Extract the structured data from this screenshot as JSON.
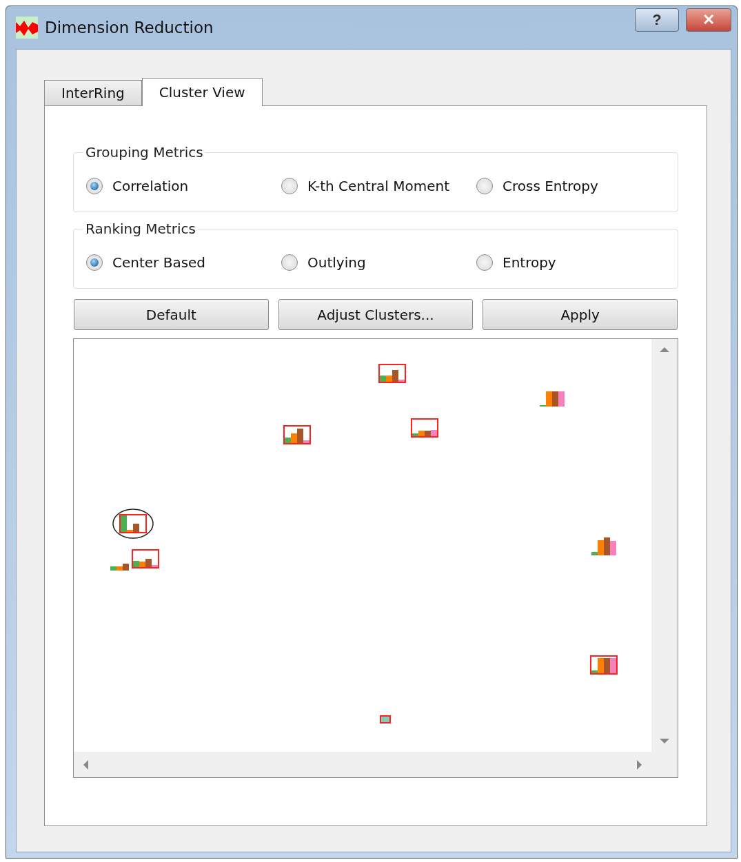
{
  "window": {
    "title": "Dimension Reduction",
    "buttons": [
      {
        "kind": "help",
        "label": "?"
      },
      {
        "kind": "close",
        "label": "✕"
      }
    ]
  },
  "tabs": [
    {
      "label": "InterRing",
      "selected": false
    },
    {
      "label": "Cluster View",
      "selected": true
    }
  ],
  "groups": [
    {
      "title": "Grouping Metrics",
      "options": [
        {
          "label": "Correlation",
          "selected": true
        },
        {
          "label": "K-th Central Moment",
          "selected": false
        },
        {
          "label": "Cross Entropy",
          "selected": false
        }
      ]
    },
    {
      "title": "Ranking Metrics",
      "options": [
        {
          "label": "Center Based",
          "selected": true
        },
        {
          "label": "Outlying",
          "selected": false
        },
        {
          "label": "Entropy",
          "selected": false
        }
      ]
    }
  ],
  "buttons": [
    "Default",
    "Adjust Clusters...",
    "Apply"
  ],
  "cluster_view": {
    "clusters": [
      {
        "framed": true,
        "circled": false
      },
      {
        "framed": false,
        "circled": false
      },
      {
        "framed": true,
        "circled": false
      },
      {
        "framed": true,
        "circled": false
      },
      {
        "framed": true,
        "circled": true
      },
      {
        "framed": false,
        "circled": false
      },
      {
        "framed": true,
        "circled": false
      },
      {
        "framed": false,
        "circled": false
      },
      {
        "framed": true,
        "circled": false
      },
      {
        "framed": true,
        "circled": false
      }
    ]
  }
}
